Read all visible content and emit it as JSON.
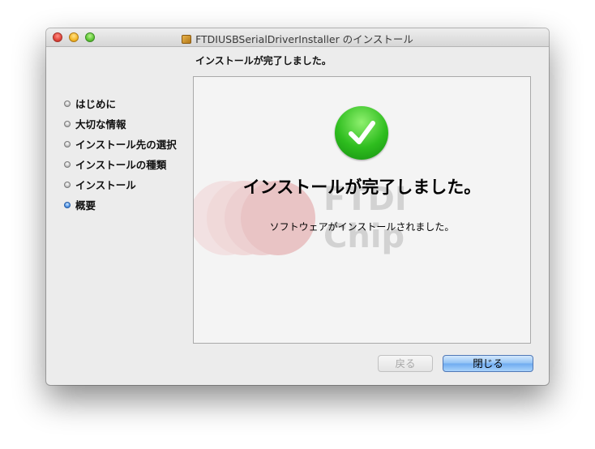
{
  "window": {
    "title": "FTDIUSBSerialDriverInstaller のインストール",
    "icon": "package-icon"
  },
  "page": {
    "heading": "インストールが完了しました。"
  },
  "sidebar": {
    "steps": [
      {
        "label": "はじめに",
        "active": false
      },
      {
        "label": "大切な情報",
        "active": false
      },
      {
        "label": "インストール先の選択",
        "active": false
      },
      {
        "label": "インストールの種類",
        "active": false
      },
      {
        "label": "インストール",
        "active": false
      },
      {
        "label": "概要",
        "active": true
      }
    ]
  },
  "content": {
    "icon": "success-check-icon",
    "message_title": "インストールが完了しました。",
    "message_body": "ソフトウェアがインストールされました。",
    "watermark_text_line1": "FTDI",
    "watermark_text_line2": "Chip"
  },
  "buttons": {
    "back": "戻る",
    "close": "閉じる"
  },
  "colors": {
    "accent": "#6eaaf0",
    "success": "#2ebd1e",
    "watermark_red": "#d9777a",
    "watermark_gray": "#b3b3b3"
  }
}
